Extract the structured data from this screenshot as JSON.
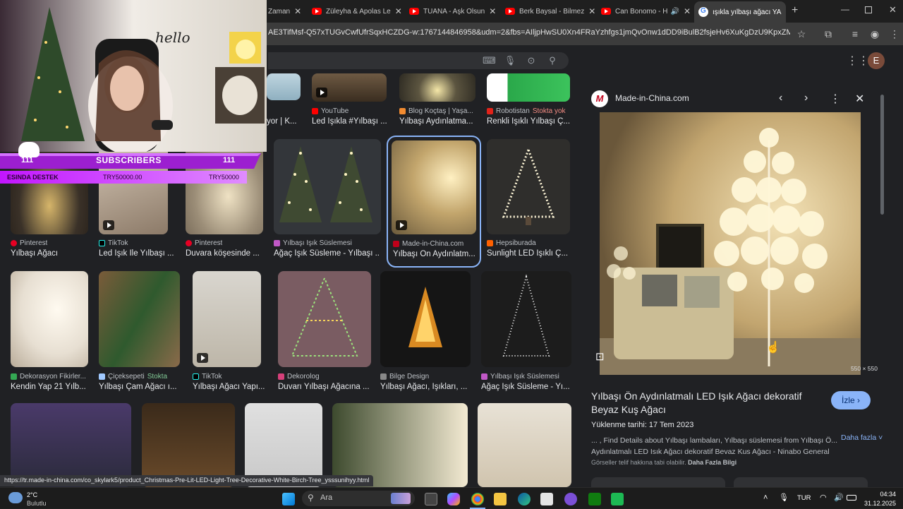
{
  "browser": {
    "tabs": [
      {
        "title": "Zaman"
      },
      {
        "title": "Züleyha & Apolas Le"
      },
      {
        "title": "TUANA - Aşk Olsun"
      },
      {
        "title": "Berk Baysal - Bilmez"
      },
      {
        "title": "Can Bonomo - H"
      },
      {
        "title": "ışıkla yılbaşı ağacı YA"
      }
    ],
    "new_tab": "+",
    "url": "AE3TifMsf-Q57xTUGvCwfUfrSqxHCZDG-w:1767144846958&udm=2&fbs=AIljpHwSU0Xn4FRaYzhfgs1jmQvOnw1dDD9iBulB2fsjeHv6XuKgDzU9KpxZMcpsjQN...",
    "profile_initial": "E"
  },
  "results": {
    "row0": [
      {
        "source": "",
        "caption": "yor | K..."
      },
      {
        "source": "YouTube",
        "caption": "Led Işıkla #Yılbaşı ..."
      },
      {
        "source": "Blog Koçtaş | Yaşa...",
        "caption": "Yılbaşı Aydınlatma..."
      },
      {
        "source": "Robotistan",
        "stock": "Stokta yok",
        "caption": "Renkli Işıklı Yılbaşı Ç..."
      }
    ],
    "row1": [
      {
        "source": "Pinterest",
        "caption": "Yılbaşı Ağacı"
      },
      {
        "source": "TikTok",
        "caption": "Led Işık Ile Yılbaşı ..."
      },
      {
        "source": "Pinterest",
        "caption": "Duvara köşesinde ..."
      },
      {
        "source": "Yılbaşı Işık Süslemesi",
        "caption": "Ağaç Işık Süsleme - Yılbaşı ..."
      },
      {
        "source": "Made-in-China.com",
        "caption": "Yılbaşı Ön Aydınlatm..."
      },
      {
        "source": "Hepsiburada",
        "caption": "Sunlight LED Işıklı Ç..."
      }
    ],
    "row2": [
      {
        "source": "Dekorasyon Fikirler...",
        "caption": "Kendin Yap 21 Yılb..."
      },
      {
        "source": "Çiçeksepeti",
        "stock": "Stokta",
        "caption": "Yılbaşı Çam Ağacı ı..."
      },
      {
        "source": "TikTok",
        "caption": "Yılbaşı Ağacı Yapı..."
      },
      {
        "source": "Dekorolog",
        "caption": "Duvarı Yılbaşı Ağacına ..."
      },
      {
        "source": "Bilge Design",
        "caption": "Yılbaşı Ağacı, Işıkları, ..."
      },
      {
        "source": "Yılbaşı Işık Süslemesi",
        "caption": "Ağaç Işık Süsleme - Yı..."
      }
    ]
  },
  "panel": {
    "source": "Made-in-China.com",
    "dims": "550 × 550",
    "title": "Yılbaşı Ön Aydınlatmalı LED Işık Ağacı dekoratif Beyaz Kuş Ağacı",
    "visit_label": "İzle",
    "date": "Yüklenme tarihi: 17 Tem 2023",
    "description": "... , Find Details about Yılbaşı lambaları, Yılbaşı süslemesi from Yılbaşı Ö... Aydınlatmalı LED Isık Ağacı dekoratif Bevaz Kus Ağacı - Ninabo General",
    "more_label": "Daha fazla",
    "copyright_text": "Görseller telif hakkına tabi olabilir.",
    "copyright_link": "Daha Fazla Bilgi"
  },
  "status_url": "https://tr.made-in-china.com/co_skylark5/product_Christmas-Pre-Lit-LED-Light-Tree-Decorative-White-Birch-Tree_ysssunihyy.html",
  "overlay": {
    "sub_left": "111",
    "sub_label": "SUBSCRIBERS",
    "sub_right": "111",
    "don_label": "ESINDA DESTEK",
    "don_amount1": "TRY50000.00",
    "don_amount2": "TRY50000",
    "hello_text": "hello"
  },
  "taskbar": {
    "temp": "2°C",
    "weather": "Bulutlu",
    "search": "Ara",
    "lang": "TUR",
    "time": "04:34",
    "date": "31.12.2025"
  },
  "colors": {
    "accent": "#8ab4f8",
    "youtube": "#ff0000",
    "pinterest": "#e60023",
    "made_in_china": "#c0001a"
  }
}
